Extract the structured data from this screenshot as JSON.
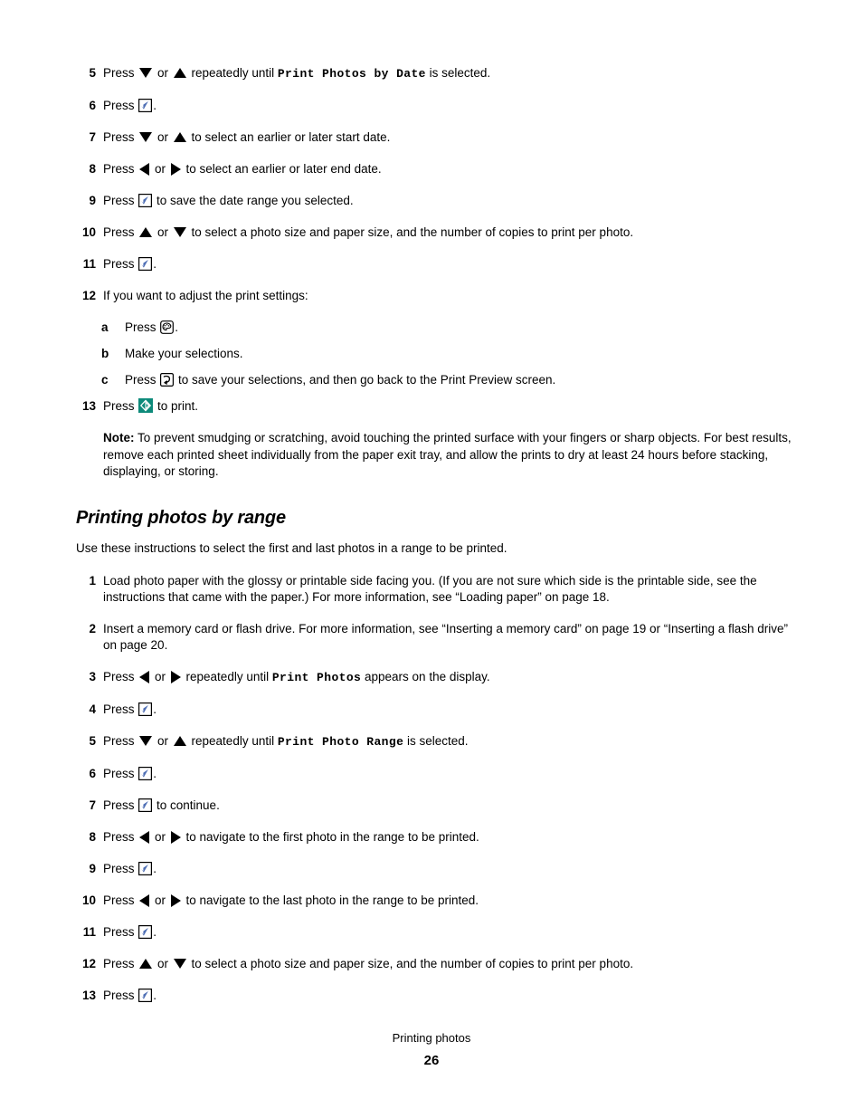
{
  "footer": {
    "title": "Printing photos",
    "page_number": "26"
  },
  "colors": {
    "check_blue": "#4f6fb5",
    "print_teal": "#0d8a7a",
    "text": "#000000"
  },
  "section_one": {
    "steps": [
      {
        "num": "5",
        "parts": [
          {
            "t": "text",
            "v": "Press "
          },
          {
            "t": "icon",
            "v": "arrow-down-icon"
          },
          {
            "t": "text",
            "v": " or "
          },
          {
            "t": "icon",
            "v": "arrow-up-icon"
          },
          {
            "t": "text",
            "v": " repeatedly until "
          },
          {
            "t": "lcd",
            "v": "Print Photos by Date"
          },
          {
            "t": "text",
            "v": " is selected."
          }
        ]
      },
      {
        "num": "6",
        "parts": [
          {
            "t": "text",
            "v": "Press "
          },
          {
            "t": "icon",
            "v": "select-checkmark-icon"
          },
          {
            "t": "text",
            "v": "."
          }
        ]
      },
      {
        "num": "7",
        "parts": [
          {
            "t": "text",
            "v": "Press "
          },
          {
            "t": "icon",
            "v": "arrow-down-icon"
          },
          {
            "t": "text",
            "v": " or "
          },
          {
            "t": "icon",
            "v": "arrow-up-icon"
          },
          {
            "t": "text",
            "v": " to select an earlier or later start date."
          }
        ]
      },
      {
        "num": "8",
        "parts": [
          {
            "t": "text",
            "v": "Press "
          },
          {
            "t": "icon",
            "v": "arrow-left-icon"
          },
          {
            "t": "text",
            "v": " or "
          },
          {
            "t": "icon",
            "v": "arrow-right-icon"
          },
          {
            "t": "text",
            "v": " to select an earlier or later end date."
          }
        ]
      },
      {
        "num": "9",
        "parts": [
          {
            "t": "text",
            "v": "Press "
          },
          {
            "t": "icon",
            "v": "select-checkmark-icon"
          },
          {
            "t": "text",
            "v": " to save the date range you selected."
          }
        ]
      },
      {
        "num": "10",
        "parts": [
          {
            "t": "text",
            "v": "Press "
          },
          {
            "t": "icon",
            "v": "arrow-up-icon"
          },
          {
            "t": "text",
            "v": " or "
          },
          {
            "t": "icon",
            "v": "arrow-down-icon"
          },
          {
            "t": "text",
            "v": " to select a photo size and paper size, and the number of copies to print per photo."
          }
        ]
      },
      {
        "num": "11",
        "parts": [
          {
            "t": "text",
            "v": "Press "
          },
          {
            "t": "icon",
            "v": "select-checkmark-icon"
          },
          {
            "t": "text",
            "v": "."
          }
        ]
      }
    ],
    "step12": {
      "num": "12",
      "text": "If you want to adjust the print settings:",
      "substeps": [
        {
          "letter": "a",
          "parts": [
            {
              "t": "text",
              "v": "Press "
            },
            {
              "t": "icon",
              "v": "settings-palette-icon"
            },
            {
              "t": "text",
              "v": "."
            }
          ]
        },
        {
          "letter": "b",
          "parts": [
            {
              "t": "text",
              "v": "Make your selections."
            }
          ]
        },
        {
          "letter": "c",
          "parts": [
            {
              "t": "text",
              "v": "Press "
            },
            {
              "t": "icon",
              "v": "back-return-icon"
            },
            {
              "t": "text",
              "v": " to save your selections, and then go back to the Print Preview screen."
            }
          ]
        }
      ]
    },
    "step13": {
      "num": "13",
      "parts": [
        {
          "t": "text",
          "v": "Press "
        },
        {
          "t": "icon",
          "v": "print-start-icon"
        },
        {
          "t": "text",
          "v": " to print."
        }
      ]
    },
    "note": {
      "label": "Note:",
      "text": " To prevent smudging or scratching, avoid touching the printed surface with your fingers or sharp objects. For best results, remove each printed sheet individually from the paper exit tray, and allow the prints to dry at least 24 hours before stacking, displaying, or storing."
    }
  },
  "section_two": {
    "title": "Printing photos by range",
    "intro": "Use these instructions to select the first and last photos in a range to be printed.",
    "steps": [
      {
        "num": "1",
        "parts": [
          {
            "t": "text",
            "v": "Load photo paper with the glossy or printable side facing you. (If you are not sure which side is the printable side, see the instructions that came with the paper.) For more information, see “Loading paper” on page 18."
          }
        ]
      },
      {
        "num": "2",
        "parts": [
          {
            "t": "text",
            "v": "Insert a memory card or flash drive. For more information, see “Inserting a memory card” on page 19 or “Inserting a flash drive” on page 20."
          }
        ]
      },
      {
        "num": "3",
        "parts": [
          {
            "t": "text",
            "v": "Press "
          },
          {
            "t": "icon",
            "v": "arrow-left-icon"
          },
          {
            "t": "text",
            "v": " or "
          },
          {
            "t": "icon",
            "v": "arrow-right-icon"
          },
          {
            "t": "text",
            "v": " repeatedly until "
          },
          {
            "t": "lcd",
            "v": "Print Photos"
          },
          {
            "t": "text",
            "v": " appears on the display."
          }
        ]
      },
      {
        "num": "4",
        "parts": [
          {
            "t": "text",
            "v": "Press "
          },
          {
            "t": "icon",
            "v": "select-checkmark-icon"
          },
          {
            "t": "text",
            "v": "."
          }
        ]
      },
      {
        "num": "5",
        "parts": [
          {
            "t": "text",
            "v": "Press "
          },
          {
            "t": "icon",
            "v": "arrow-down-icon"
          },
          {
            "t": "text",
            "v": " or "
          },
          {
            "t": "icon",
            "v": "arrow-up-icon"
          },
          {
            "t": "text",
            "v": " repeatedly until "
          },
          {
            "t": "lcd",
            "v": "Print Photo Range"
          },
          {
            "t": "text",
            "v": " is selected."
          }
        ]
      },
      {
        "num": "6",
        "parts": [
          {
            "t": "text",
            "v": "Press "
          },
          {
            "t": "icon",
            "v": "select-checkmark-icon"
          },
          {
            "t": "text",
            "v": "."
          }
        ]
      },
      {
        "num": "7",
        "parts": [
          {
            "t": "text",
            "v": "Press "
          },
          {
            "t": "icon",
            "v": "select-checkmark-icon"
          },
          {
            "t": "text",
            "v": " to continue."
          }
        ]
      },
      {
        "num": "8",
        "parts": [
          {
            "t": "text",
            "v": "Press "
          },
          {
            "t": "icon",
            "v": "arrow-left-icon"
          },
          {
            "t": "text",
            "v": " or "
          },
          {
            "t": "icon",
            "v": "arrow-right-icon"
          },
          {
            "t": "text",
            "v": " to navigate to the first photo in the range to be printed."
          }
        ]
      },
      {
        "num": "9",
        "parts": [
          {
            "t": "text",
            "v": "Press "
          },
          {
            "t": "icon",
            "v": "select-checkmark-icon"
          },
          {
            "t": "text",
            "v": "."
          }
        ]
      },
      {
        "num": "10",
        "parts": [
          {
            "t": "text",
            "v": "Press "
          },
          {
            "t": "icon",
            "v": "arrow-left-icon"
          },
          {
            "t": "text",
            "v": " or "
          },
          {
            "t": "icon",
            "v": "arrow-right-icon"
          },
          {
            "t": "text",
            "v": " to navigate to the last photo in the range to be printed."
          }
        ]
      },
      {
        "num": "11",
        "parts": [
          {
            "t": "text",
            "v": "Press "
          },
          {
            "t": "icon",
            "v": "select-checkmark-icon"
          },
          {
            "t": "text",
            "v": "."
          }
        ]
      },
      {
        "num": "12",
        "parts": [
          {
            "t": "text",
            "v": "Press "
          },
          {
            "t": "icon",
            "v": "arrow-up-icon"
          },
          {
            "t": "text",
            "v": " or "
          },
          {
            "t": "icon",
            "v": "arrow-down-icon"
          },
          {
            "t": "text",
            "v": " to select a photo size and paper size, and the number of copies to print per photo."
          }
        ]
      },
      {
        "num": "13",
        "parts": [
          {
            "t": "text",
            "v": "Press "
          },
          {
            "t": "icon",
            "v": "select-checkmark-icon"
          },
          {
            "t": "text",
            "v": "."
          }
        ]
      }
    ]
  }
}
